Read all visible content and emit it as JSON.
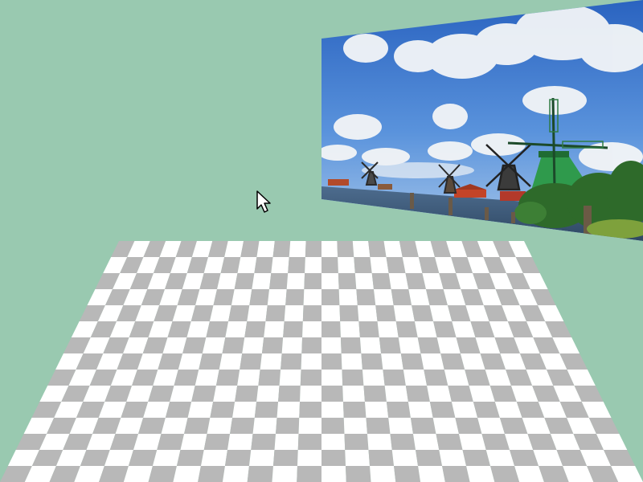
{
  "scene": {
    "background_color": "#99c9b0",
    "floor": {
      "kind": "checkerboard",
      "rows": 15,
      "cols": 26,
      "light_color": "#ffffff",
      "dark_color": "#b8b8b8"
    },
    "photo": {
      "kind": "landscape-photo",
      "subject": "windmills-by-river",
      "sky_color": "#2f6fce",
      "cloud_color": "#f4f6f8",
      "water_color": "#3c5a7c",
      "windmill_color": "#2f8f48",
      "tree_color": "#2e6a2a"
    }
  },
  "cursor": {
    "icon": "arrow-pointer-icon"
  }
}
